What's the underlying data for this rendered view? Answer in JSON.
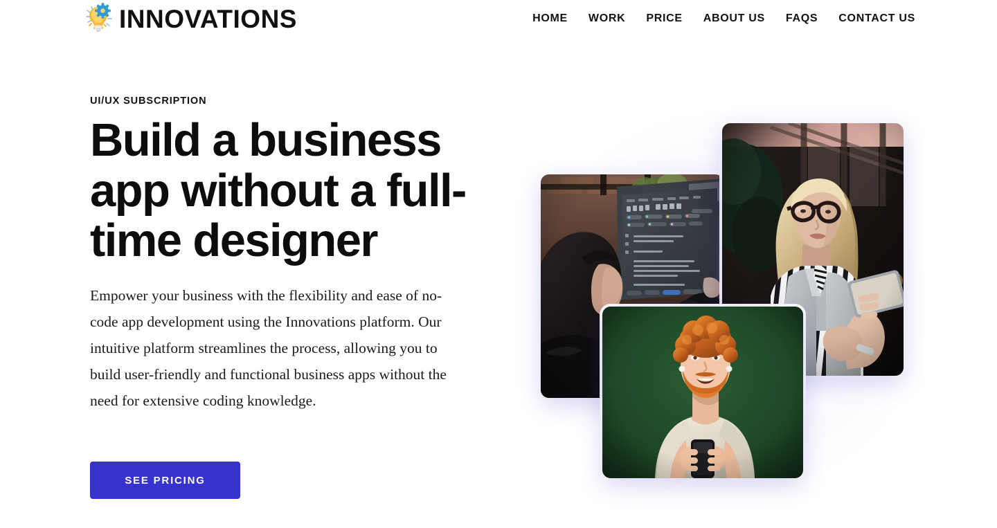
{
  "header": {
    "brand": {
      "name": "INNOVATIONS",
      "icon": "lightbulb-gear-icon"
    },
    "nav": [
      {
        "label": "HOME"
      },
      {
        "label": "WORK"
      },
      {
        "label": "PRICE"
      },
      {
        "label": "ABOUT US"
      },
      {
        "label": "FAQS"
      },
      {
        "label": "CONTACT US"
      }
    ]
  },
  "hero": {
    "eyebrow": "UI/UX SUBSCRIPTION",
    "title": "Build a business app without a full-time designer",
    "paragraph": "Empower your business with the flexibility and ease of no-code app development using the Innovations platform. Our intuitive platform streamlines the process, allowing you to build user-friendly and functional business apps without the need for extensive coding knowledge.",
    "cta_label": "SEE PRICING",
    "colors": {
      "cta_background": "#3632ce",
      "cta_text": "#ffffff",
      "page_background": "#ffffff",
      "heading_text": "#0d0d0d"
    },
    "collage": [
      {
        "name": "photo-woman-at-monitor",
        "description": "Dark-haired woman looking at a monitor showing a dark code editor interface"
      },
      {
        "name": "photo-woman-with-tablet",
        "description": "Blonde woman with black glasses holding a tablet outdoors at dusk"
      },
      {
        "name": "photo-man-with-phone",
        "description": "Smiling red-haired bearded man in a cream t-shirt holding a phone on a dark green background"
      }
    ]
  }
}
